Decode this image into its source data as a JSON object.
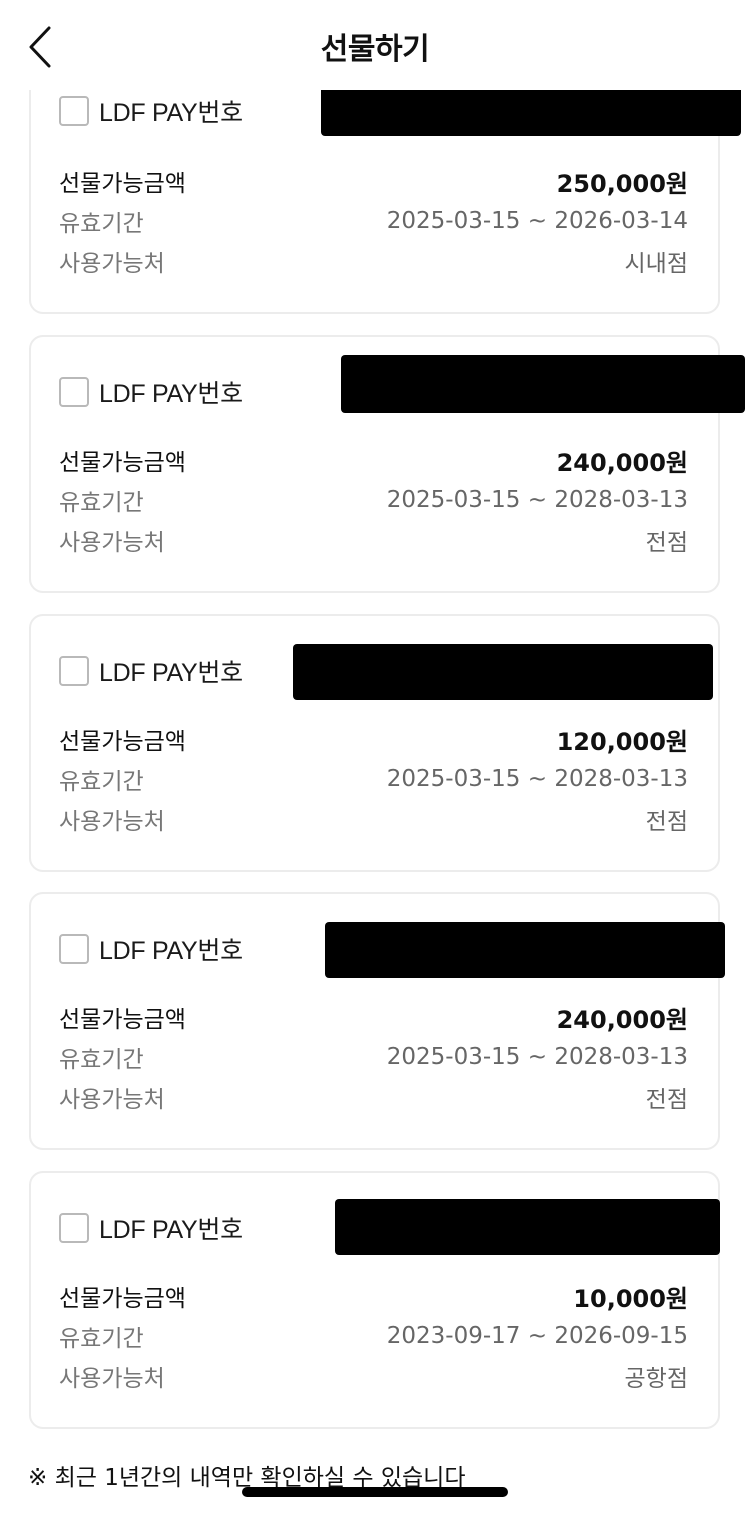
{
  "header": {
    "title": "선물하기",
    "back_icon": "chevron-left-icon"
  },
  "labels": {
    "pay_number": "LDF PAY번호",
    "amount": "선물가능금액",
    "validity": "유효기간",
    "usable_at": "사용가능처"
  },
  "cards": [
    {
      "amount": "250,000원",
      "validity": "2025-03-15 ~ 2026-03-14",
      "usable_at": "시내점"
    },
    {
      "amount": "240,000원",
      "validity": "2025-03-15 ~ 2028-03-13",
      "usable_at": "전점"
    },
    {
      "amount": "120,000원",
      "validity": "2025-03-15 ~ 2028-03-13",
      "usable_at": "전점"
    },
    {
      "amount": "240,000원",
      "validity": "2025-03-15 ~ 2028-03-13",
      "usable_at": "전점"
    },
    {
      "amount": "10,000원",
      "validity": "2023-09-17 ~ 2026-09-15",
      "usable_at": "공항점"
    }
  ],
  "footer": {
    "note": "※ 최근 1년간의 내역만 확인하실 수 있습니다"
  }
}
